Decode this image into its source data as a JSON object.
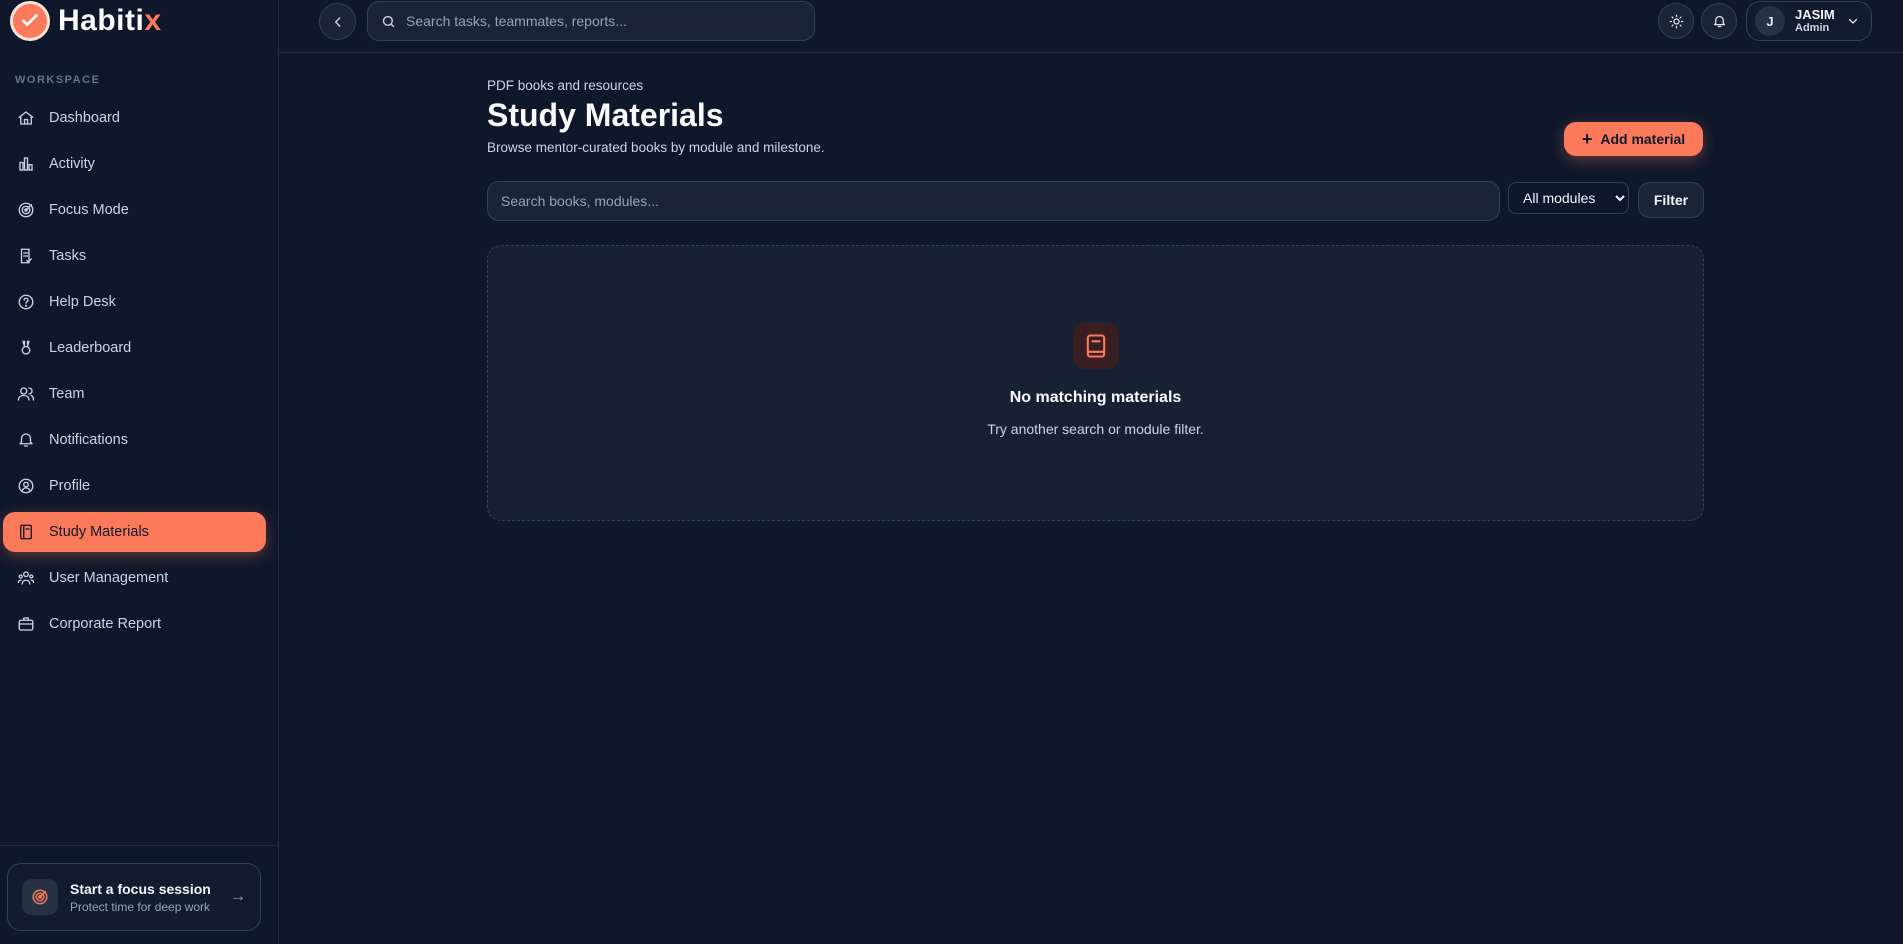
{
  "brand": {
    "name_main": "Habiti",
    "name_accent": "x"
  },
  "sidebar": {
    "section_label": "WORKSPACE",
    "items": [
      {
        "label": "Dashboard",
        "icon": "home-icon"
      },
      {
        "label": "Activity",
        "icon": "bar-chart-icon"
      },
      {
        "label": "Focus Mode",
        "icon": "target-icon"
      },
      {
        "label": "Tasks",
        "icon": "clipboard-check-icon"
      },
      {
        "label": "Help Desk",
        "icon": "help-circle-icon"
      },
      {
        "label": "Leaderboard",
        "icon": "award-icon"
      },
      {
        "label": "Team",
        "icon": "users-icon"
      },
      {
        "label": "Notifications",
        "icon": "bell-icon"
      },
      {
        "label": "Profile",
        "icon": "user-circle-icon"
      },
      {
        "label": "Study Materials",
        "icon": "book-icon",
        "active": true
      },
      {
        "label": "User Management",
        "icon": "user-group-icon"
      },
      {
        "label": "Corporate Report",
        "icon": "briefcase-icon"
      }
    ],
    "focus_card": {
      "title": "Start a focus session",
      "subtitle": "Protect time for deep work"
    }
  },
  "topbar": {
    "search_placeholder": "Search tasks, teammates, reports...",
    "user": {
      "initial": "J",
      "name": "JASIM",
      "role": "Admin"
    }
  },
  "main": {
    "eyebrow": "PDF books and resources",
    "title": "Study Materials",
    "subtitle": "Browse mentor-curated books by module and milestone.",
    "add_label": "Add material",
    "search_placeholder": "Search books, modules...",
    "module_select": {
      "selected": "All modules"
    },
    "filter_label": "Filter",
    "empty": {
      "title": "No matching materials",
      "subtitle": "Try another search or module filter."
    }
  },
  "colors": {
    "accent": "#fb7a5c",
    "background": "#0f172a",
    "surface": "#1b2435"
  }
}
